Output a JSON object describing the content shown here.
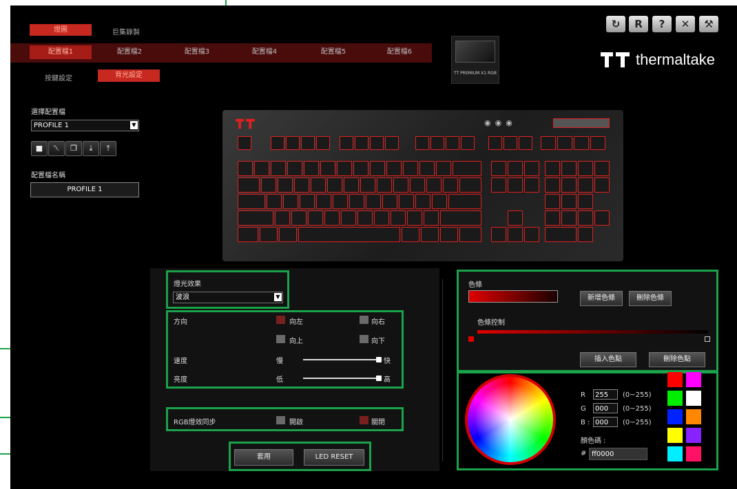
{
  "app": {
    "top_menu": [
      "燈圖",
      "巨集錄製"
    ],
    "profile_tabs": [
      "配置檔1",
      "配置檔2",
      "配置檔3",
      "配置檔4",
      "配置檔5",
      "配置檔6"
    ],
    "sub_tabs": [
      "按鍵設定",
      "背光設定"
    ],
    "device_label": "TT PREMIUM X1 RGB",
    "brand": "thermaltake",
    "toolbar_icons": [
      "refresh-icon",
      "r-icon",
      "help-icon",
      "close-icon",
      "settings-icon"
    ]
  },
  "left_panel": {
    "select_profile_label": "選擇配置檔",
    "select_profile_value": "PROFILE 1",
    "profile_name_label": "配置檔名稱",
    "profile_name_value": "PROFILE 1"
  },
  "lighting": {
    "effect_label": "燈光效果",
    "effect_value": "波浪",
    "direction_label": "方向",
    "dir_left": "向左",
    "dir_right": "向右",
    "dir_up": "向上",
    "dir_down": "向下",
    "speed_label": "速度",
    "speed_min": "慢",
    "speed_max": "快",
    "speed_value": 1.0,
    "brightness_label": "亮度",
    "brightness_min": "低",
    "brightness_max": "高",
    "brightness_value": 1.0,
    "rgb_sync_label": "RGB燈效同步",
    "rgb_on": "開啟",
    "rgb_off": "關閉",
    "apply_btn": "套用",
    "reset_btn": "LED RESET"
  },
  "color_bar": {
    "title": "色條",
    "add_btn": "新增色條",
    "delete_btn": "刪除色條",
    "control_label": "色條控制",
    "insert_point_btn": "插入色點",
    "delete_point_btn": "刪除色點"
  },
  "color_picker": {
    "r_label": "R",
    "g_label": "G",
    "b_label": "B :",
    "r_value": "255",
    "g_value": "000",
    "b_value": "000",
    "range": "(0~255)",
    "code_label": "顏色碼 :",
    "hash": "#",
    "code_value": "ff0000",
    "swatches": [
      "#ff0000",
      "#ff00ff",
      "#00ee00",
      "#ffffff",
      "#0022ff",
      "#ff8800",
      "#ffff00",
      "#8822ff",
      "#00eeff",
      "#ff1166"
    ]
  }
}
